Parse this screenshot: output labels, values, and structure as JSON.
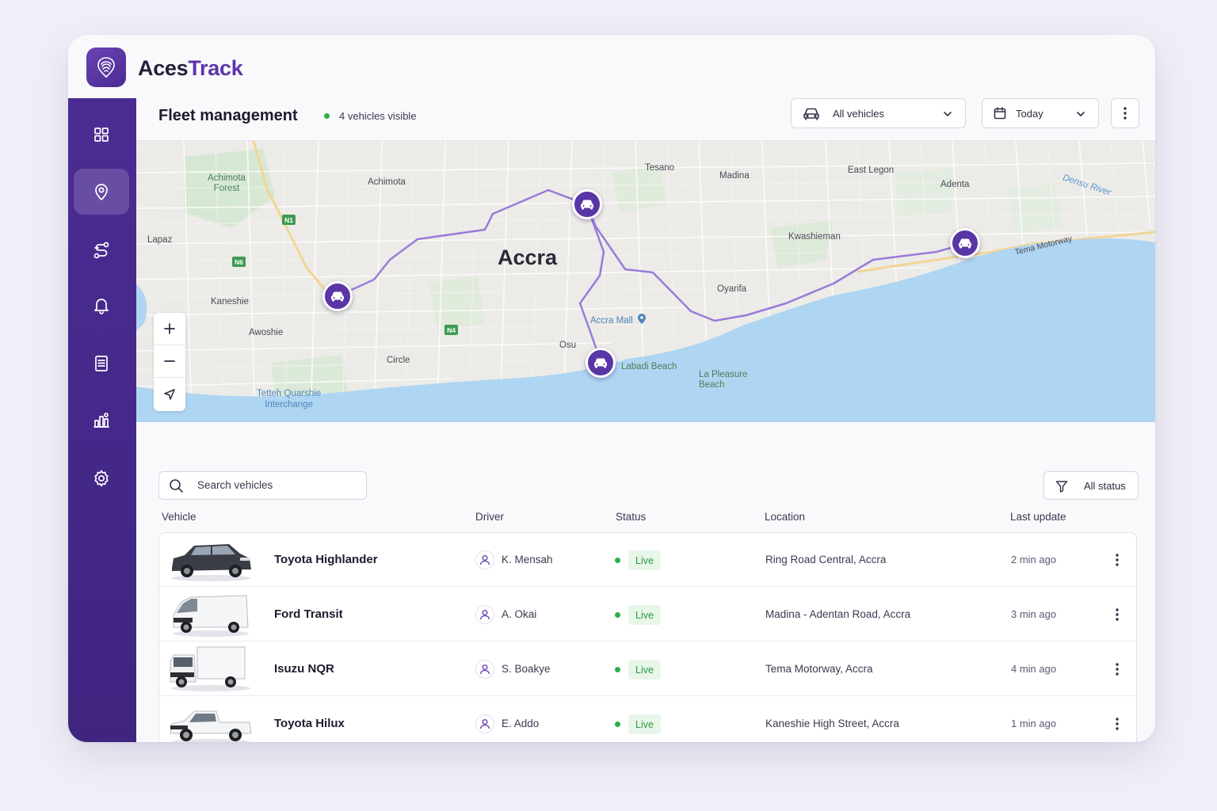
{
  "brand": {
    "name_part1": "Aces",
    "name_part2": "Track"
  },
  "sidebar": {
    "items": [
      {
        "icon": "grid-icon",
        "active": false
      },
      {
        "icon": "map-pin-icon",
        "active": true
      },
      {
        "icon": "route-icon",
        "active": false
      },
      {
        "icon": "bell-icon",
        "active": false
      },
      {
        "icon": "document-icon",
        "active": false
      },
      {
        "icon": "analytics-icon",
        "active": false
      },
      {
        "icon": "gear-icon",
        "active": false
      }
    ]
  },
  "header": {
    "title": "Fleet management",
    "visible_count": "4 vehicles visible",
    "vehicle_filter": "All vehicles",
    "date_filter": "Today"
  },
  "map": {
    "city": "Accra",
    "labels": {
      "achimota_forest": "Achimota\nForest",
      "achimota": "Achimota",
      "tesano": "Tesano",
      "madina": "Madina",
      "east_legon": "East Legon",
      "adenta": "Adenta",
      "densu_river": "Densu River",
      "lapaz": "Lapaz",
      "kwashieman": "Kwashieman",
      "tema_motorway": "Tema Motorway",
      "kaneshie": "Kaneshie",
      "oyarifa": "Oyarifa",
      "awoshie": "Awoshie",
      "accra_mall": "Accra Mall",
      "osu": "Osu",
      "circle": "Circle",
      "labadi_beach": "Labadi Beach",
      "la_pleasure_beach": "La Pleasure\nBeach",
      "tetteh_quarshie": "Tetteh Quarshie\nInterchange"
    },
    "road_shields": {
      "n1": "N1",
      "n6": "N6",
      "n4": "N4"
    },
    "zoom_in": "+",
    "zoom_out": "−"
  },
  "search": {
    "placeholder": "Search vehicles"
  },
  "status_filter": "All status",
  "table": {
    "headers": {
      "vehicle": "Vehicle",
      "driver": "Driver",
      "status": "Status",
      "location": "Location",
      "last_update": "Last update"
    },
    "rows": [
      {
        "vehicle": "Toyota Highlander",
        "driver": "K. Mensah",
        "status": "Live",
        "location": "Ring Road Central, Accra",
        "last_update": "2 min ago"
      },
      {
        "vehicle": "Ford Transit",
        "driver": "A. Okai",
        "status": "Live",
        "location": "Madina - Adentan Road, Accra",
        "last_update": "3 min ago"
      },
      {
        "vehicle": "Isuzu NQR",
        "driver": "S. Boakye",
        "status": "Live",
        "location": "Tema Motorway, Accra",
        "last_update": "4 min ago"
      },
      {
        "vehicle": "Toyota Hilux",
        "driver": "E. Addo",
        "status": "Live",
        "location": "Kaneshie High Street, Accra",
        "last_update": "1 min ago"
      }
    ]
  },
  "colors": {
    "primary": "#4b2c93",
    "accent": "#5b35a8",
    "route": "#9a7ad9",
    "live": "#2bb04a",
    "water": "#a9d3f2"
  }
}
